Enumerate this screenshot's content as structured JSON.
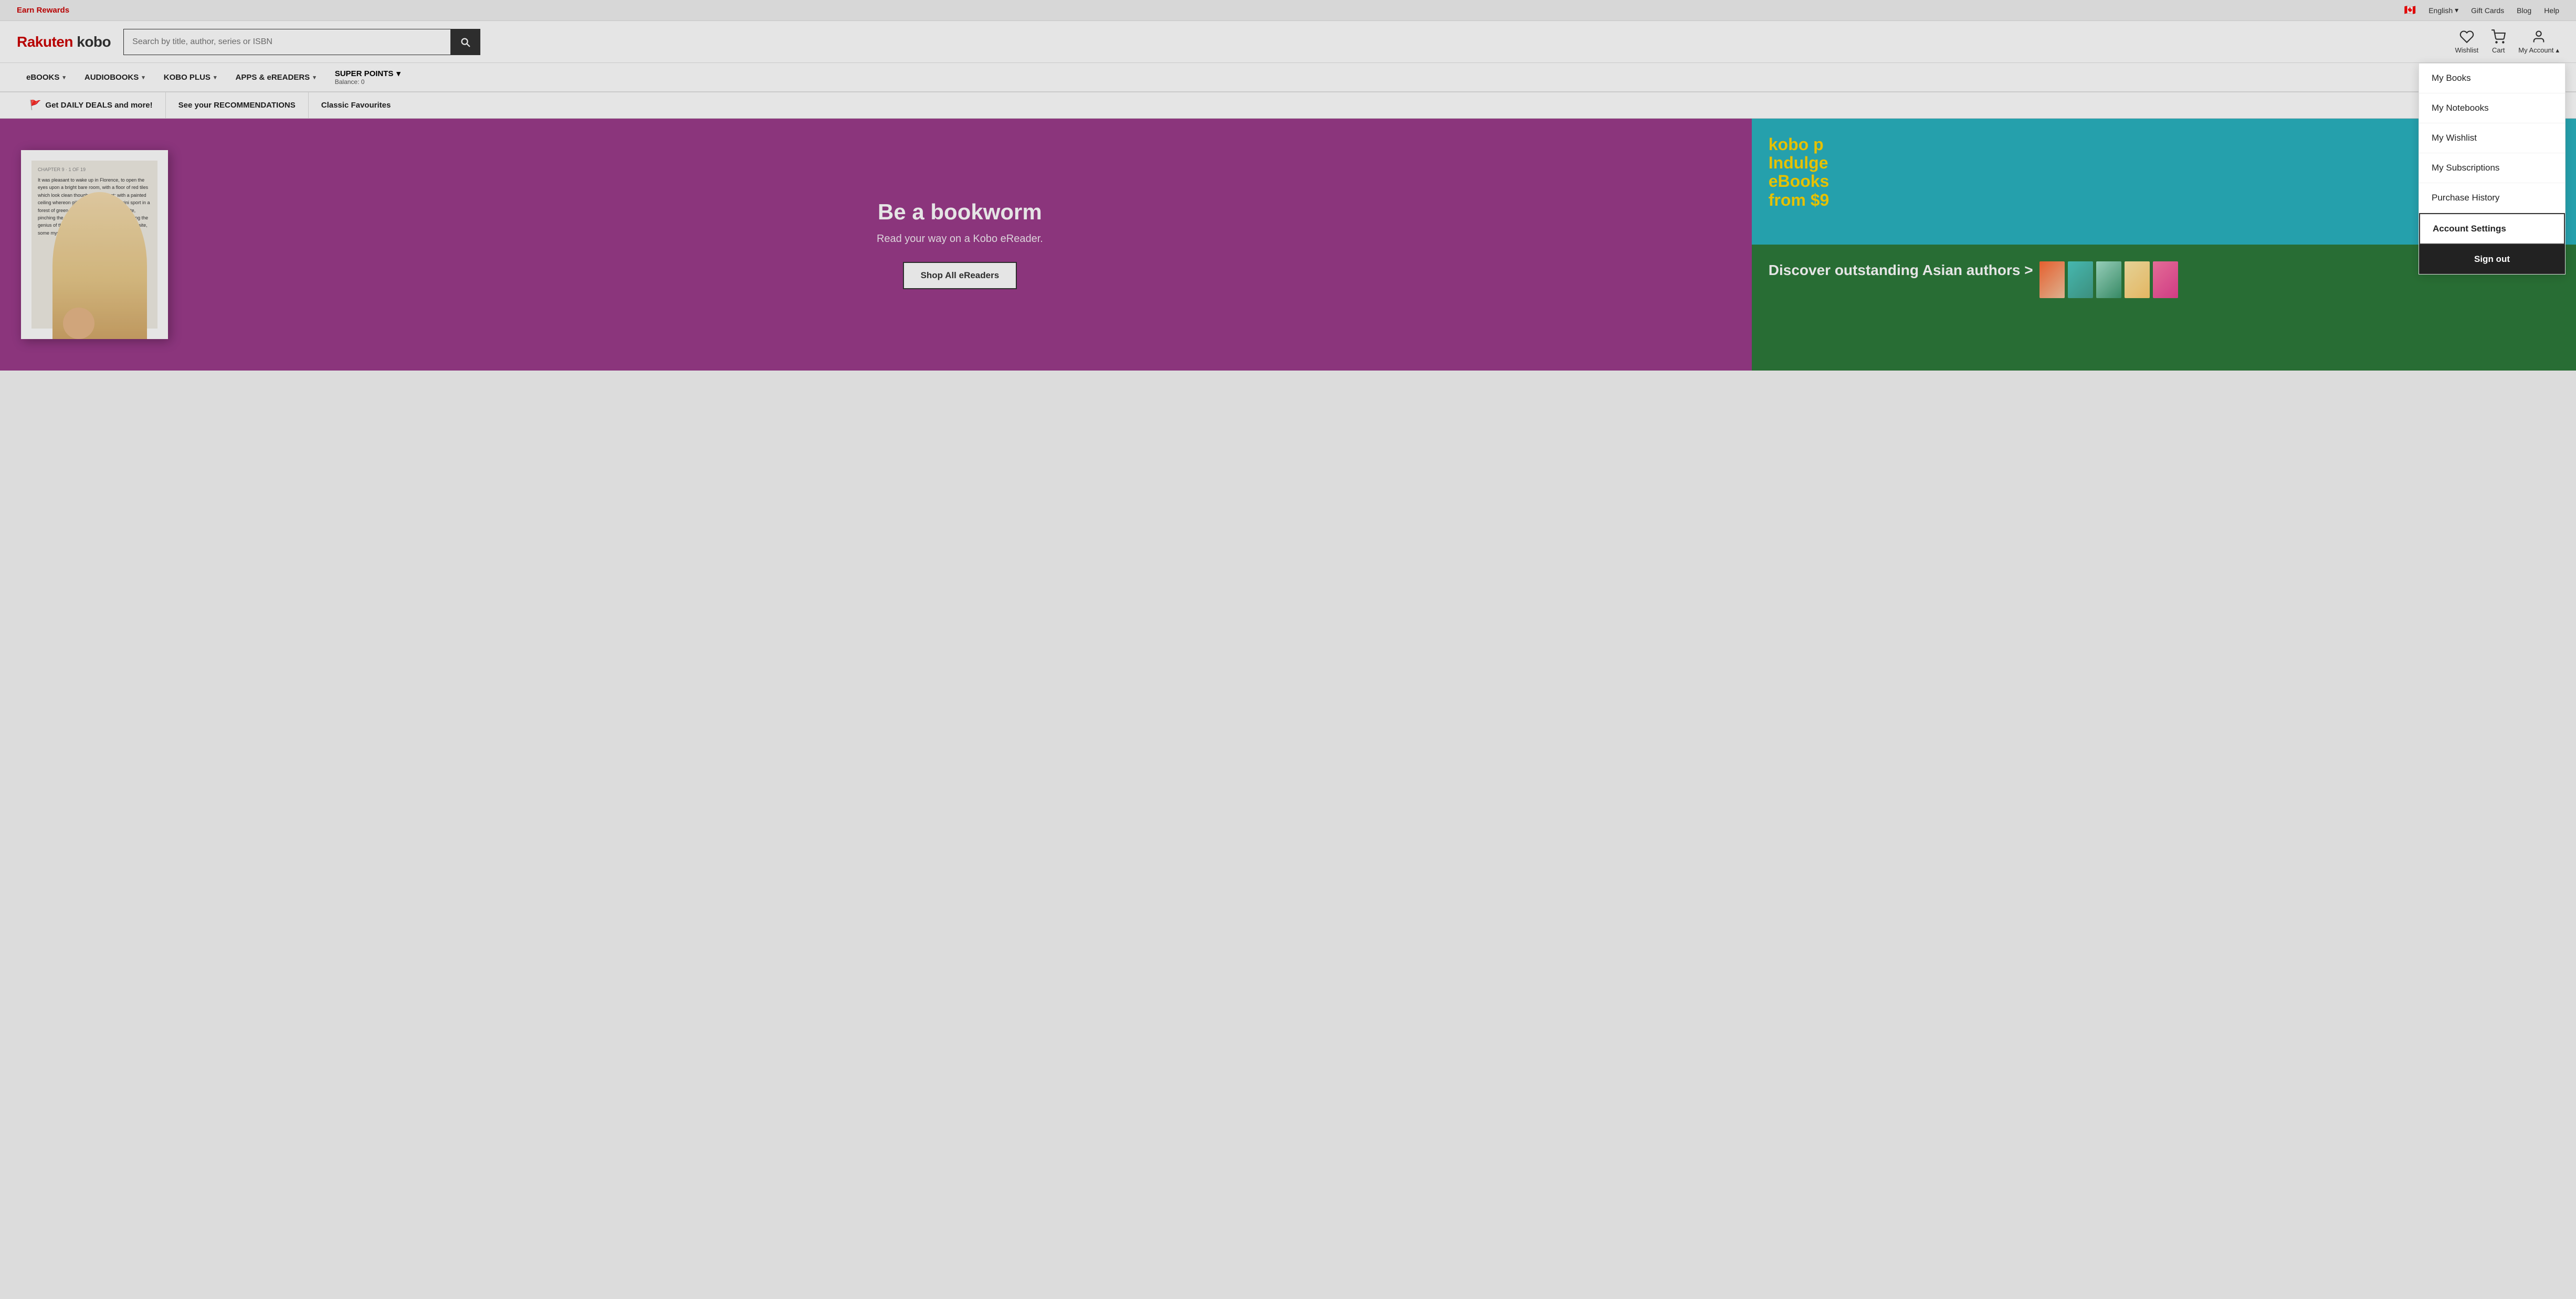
{
  "topbar": {
    "earn_rewards": "Earn Rewards",
    "flag": "🇨🇦",
    "language": "English",
    "gift_cards": "Gift Cards",
    "blog": "Blog",
    "help": "Help"
  },
  "header": {
    "logo_rakuten": "Rakuten",
    "logo_kobo": " kobo",
    "search_placeholder": "Search by title, author, series or ISBN",
    "wishlist_label": "Wishlist",
    "cart_label": "Cart",
    "account_label": "My Account"
  },
  "nav": {
    "items": [
      {
        "label": "eBOOKS",
        "has_chevron": true
      },
      {
        "label": "AUDIOBOOKS",
        "has_chevron": true
      },
      {
        "label": "KOBO PLUS",
        "has_chevron": true
      },
      {
        "label": "APPS & eREADERS",
        "has_chevron": true
      },
      {
        "label": "SUPER POINTS",
        "has_chevron": true,
        "balance": "Balance: 0"
      }
    ]
  },
  "promo_bar": {
    "items": [
      {
        "label": "Get DAILY DEALS and more!",
        "has_flag": true
      },
      {
        "label": "See your RECOMMENDATIONS",
        "has_flag": false
      },
      {
        "label": "Classic Favourites",
        "has_flag": false
      }
    ]
  },
  "hero": {
    "headline": "Be a bookworm",
    "subline": "Read your way on a Kobo eReader.",
    "cta_button": "Shop All eReaders",
    "right_top_line1": "kobo p",
    "right_top_line2": "Indulge",
    "right_top_line3": "eBooks",
    "right_top_line4": "from $9",
    "right_bottom_headline": "Discover outstanding Asian authors >"
  },
  "account_dropdown": {
    "items": [
      {
        "label": "My Books",
        "highlighted": false
      },
      {
        "label": "My Notebooks",
        "highlighted": false
      },
      {
        "label": "My Wishlist",
        "highlighted": false
      },
      {
        "label": "My Subscriptions",
        "highlighted": false
      },
      {
        "label": "Purchase History",
        "highlighted": false
      },
      {
        "label": "Account Settings",
        "highlighted": true
      }
    ],
    "signout_label": "Sign out"
  },
  "device_text": {
    "chapter": "CHAPTER 9 · 1 OF 19",
    "body": "It was pleasant to wake up in Florence, to open the eyes upon a bright bare room, with a floor of red tiles which look clean though they are not; with a painted ceiling whereon gill griffins and blue amorini sport in a forest of green, and marble churches opposite, pinching the genius from the windows, pondering the genius of the room was a marble churches opposite, some mysterious door."
  },
  "colors": {
    "accent_red": "#cc0000",
    "hero_purple": "#9b3b8b",
    "teal": "#2ab3c0",
    "green": "#2d7a3a",
    "dark": "#222222"
  }
}
